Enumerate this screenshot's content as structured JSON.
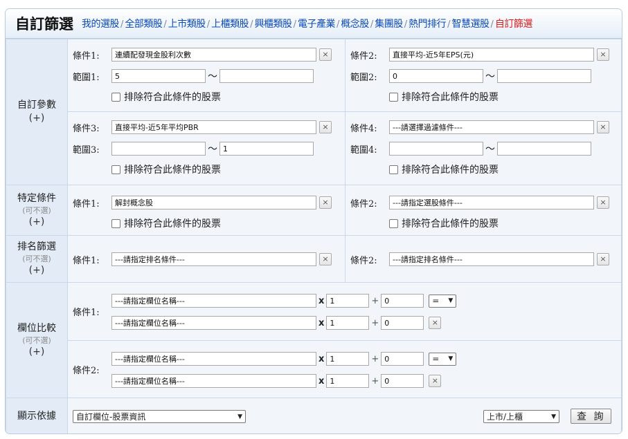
{
  "header": {
    "title": "自訂篩選",
    "nav": [
      "我的選股",
      "全部類股",
      "上市類股",
      "上櫃類股",
      "興櫃類股",
      "電子產業",
      "概念股",
      "集團股",
      "熱門排行",
      "智慧選股",
      "自訂篩選"
    ],
    "active_nav": "自訂篩選",
    "separator": "/"
  },
  "sections": {
    "custom_params": {
      "label": "自訂參數",
      "plus": "(+)"
    },
    "special": {
      "label": "特定條件",
      "optional": "(可不選)",
      "plus": "(+)"
    },
    "rank": {
      "label": "排名篩選",
      "optional": "(可不選)",
      "plus": "(+)"
    },
    "compare": {
      "label": "欄位比較",
      "optional": "(可不選)",
      "plus": "(+)"
    },
    "display": {
      "label": "顯示依據"
    }
  },
  "custom_params": [
    {
      "cond_label": "條件1:",
      "range_label": "範圍1:",
      "condition": "連續配發現金股利次數",
      "min": "5",
      "max": "",
      "exclude": "排除符合此條件的股票"
    },
    {
      "cond_label": "條件2:",
      "range_label": "範圍2:",
      "condition": "直接平均-近5年EPS(元)",
      "min": "0",
      "max": "",
      "exclude": "排除符合此條件的股票"
    },
    {
      "cond_label": "條件3:",
      "range_label": "範圍3:",
      "condition": "直接平均-近5年平均PBR",
      "min": "",
      "max": "1",
      "exclude": "排除符合此條件的股票"
    },
    {
      "cond_label": "條件4:",
      "range_label": "範圍4:",
      "condition": "---請選擇過濾條件---",
      "min": "",
      "max": "",
      "exclude": "排除符合此條件的股票"
    }
  ],
  "tilde": "～",
  "close_glyph": "×",
  "special": [
    {
      "cond_label": "條件1:",
      "condition": "解封概念股",
      "exclude": "排除符合此條件的股票"
    },
    {
      "cond_label": "條件2:",
      "condition": "---請指定選股條件---",
      "exclude": "排除符合此條件的股票"
    }
  ],
  "rank": [
    {
      "cond_label": "條件1:",
      "condition": "---請指定排名條件---"
    },
    {
      "cond_label": "條件2:",
      "condition": "---請指定排名條件---"
    }
  ],
  "compare": [
    {
      "cond_label": "條件1:",
      "a": {
        "field": "---請指定欄位名稱---",
        "mul": "1",
        "add": "0"
      },
      "b": {
        "field": "---請指定欄位名稱---",
        "mul": "1",
        "add": "0"
      },
      "operator": "="
    },
    {
      "cond_label": "條件2:",
      "a": {
        "field": "---請指定欄位名稱---",
        "mul": "1",
        "add": "0"
      },
      "b": {
        "field": "---請指定欄位名稱---",
        "mul": "1",
        "add": "0"
      },
      "operator": "="
    }
  ],
  "ops": {
    "times": "x",
    "plus": "+"
  },
  "display": {
    "view": "自訂欄位-股票資訊",
    "market": "上市/上櫃",
    "query_button": "查 詢"
  }
}
